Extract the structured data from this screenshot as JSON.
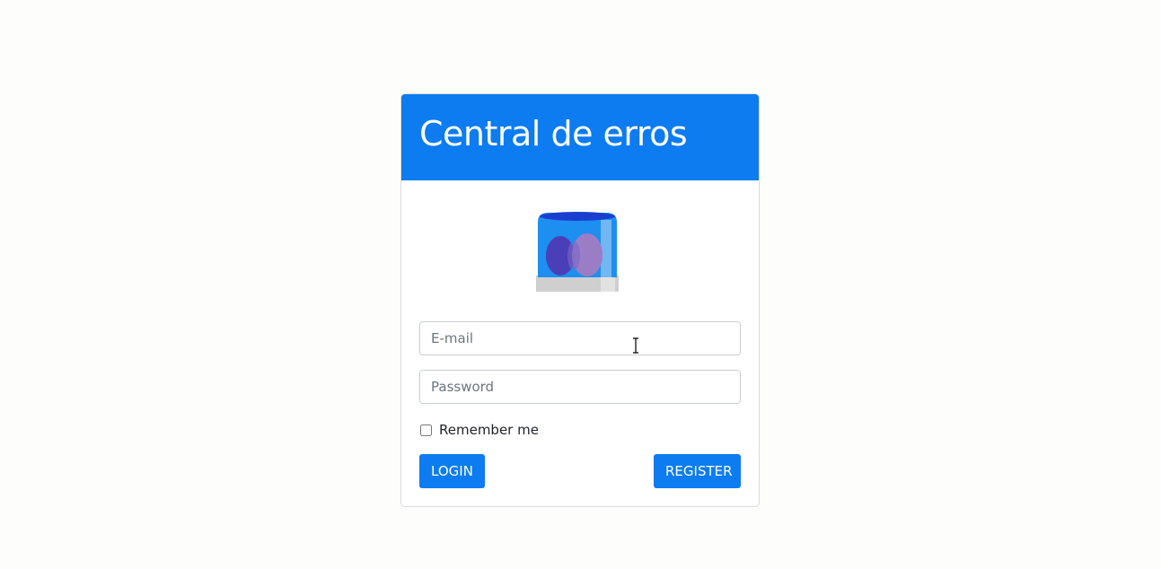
{
  "header": {
    "title": "Central de erros"
  },
  "logo": {
    "icon": "siren-alarm-icon"
  },
  "form": {
    "email_placeholder": "E-mail",
    "password_placeholder": "Password",
    "remember_label": "Remember me",
    "remember_checked": false,
    "login_label": "LOGIN",
    "register_label": "REGISTER"
  },
  "colors": {
    "primary": "#0c7cf0",
    "background": "#fdfdfb"
  }
}
